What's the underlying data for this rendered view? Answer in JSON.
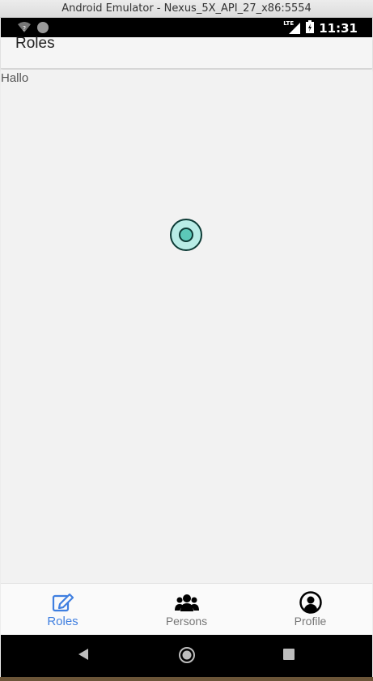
{
  "window": {
    "title": "Android Emulator - Nexus_5X_API_27_x86:5554"
  },
  "statusbar": {
    "icons_left": [
      "wifi-unknown-icon",
      "notification-dot-icon"
    ],
    "icons_right": [
      "lte-signal-icon",
      "battery-charging-icon"
    ],
    "network_label": "LTE",
    "time": "11:31"
  },
  "appbar": {
    "title": "Roles"
  },
  "content": {
    "text": "Hallo"
  },
  "bottom_nav": {
    "items": [
      {
        "label": "Roles",
        "icon": "edit-icon",
        "active": true
      },
      {
        "label": "Persons",
        "icon": "users-icon",
        "active": false
      },
      {
        "label": "Profile",
        "icon": "user-circle-icon",
        "active": false
      }
    ]
  },
  "colors": {
    "active": "#3f7fe0",
    "inactive": "#777777",
    "spinner_fill": "#b8ece6",
    "spinner_inner": "#5cc8b8"
  }
}
